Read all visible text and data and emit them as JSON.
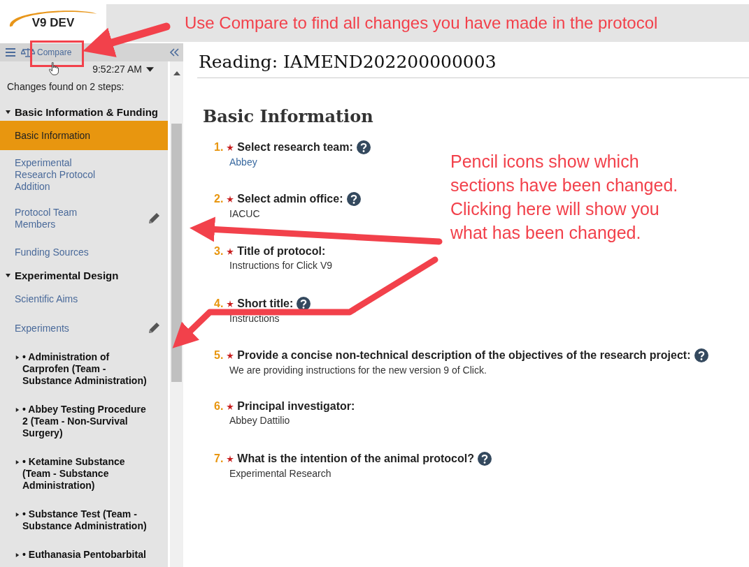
{
  "header": {
    "logo": "V9 DEV"
  },
  "annotations": [
    {
      "kind": "banner",
      "text": "Use Compare to find all changes you have made in the protocol"
    },
    {
      "kind": "callout",
      "text": "Pencil icons show which sections have been changed. Clicking here will show you what has been changed."
    }
  ],
  "sidebar": {
    "compare_button": "Compare",
    "date": "9:52:27 AM",
    "summary": "Changes found on 2 steps:",
    "sections": [
      {
        "label": "Basic Information & Funding",
        "expanded": true,
        "items": [
          {
            "kind": "link",
            "label": "Basic Information",
            "selected": true,
            "changed": false
          },
          {
            "kind": "link",
            "label": "Experimental Research Protocol Addition",
            "selected": false,
            "changed": false
          },
          {
            "kind": "link",
            "label": "Protocol Team Members",
            "selected": false,
            "changed": true
          },
          {
            "kind": "link",
            "label": "Funding Sources",
            "selected": false,
            "changed": false
          }
        ]
      },
      {
        "label": "Experimental Design",
        "expanded": true,
        "items": [
          {
            "kind": "link",
            "label": "Scientific Aims",
            "selected": false,
            "changed": false
          },
          {
            "kind": "link",
            "label": "Experiments",
            "selected": false,
            "changed": true
          },
          {
            "kind": "step",
            "label": "• Administration of Carprofen (Team - Substance Administration)",
            "expanded": false
          },
          {
            "kind": "step",
            "label": "• Abbey Testing Procedure 2 (Team - Non-Survival Surgery)",
            "expanded": false
          },
          {
            "kind": "step",
            "label": "• Ketamine Substance (Team - Substance Administration)",
            "expanded": false
          },
          {
            "kind": "step",
            "label": "• Substance Test (Team - Substance Administration)",
            "expanded": false
          },
          {
            "kind": "step",
            "label": "• Euthanasia Pentobarbital",
            "expanded": false
          }
        ]
      }
    ]
  },
  "main": {
    "title": "Reading: IAMEND202200000003",
    "section": "Basic Information",
    "questions": [
      {
        "number": "1.",
        "label": "Select research team:",
        "help": true,
        "answer": "Abbey",
        "answer_link": true
      },
      {
        "number": "2.",
        "label": "Select admin office:",
        "help": true,
        "answer": "IACUC",
        "answer_link": false
      },
      {
        "number": "3.",
        "label": "Title of protocol:",
        "help": false,
        "answer": "Instructions for Click V9",
        "answer_link": false
      },
      {
        "number": "4.",
        "label": "Short title:",
        "help": true,
        "answer": "Instructions",
        "answer_link": false
      },
      {
        "number": "5.",
        "label": "Provide a concise non-technical description of the objectives of the research project:",
        "help": true,
        "answer": "We are providing instructions for the new version 9 of Click.",
        "answer_link": false
      },
      {
        "number": "6.",
        "label": "Principal investigator:",
        "help": false,
        "answer": "Abbey Dattilio",
        "answer_link": false
      },
      {
        "number": "7.",
        "label": "What is the intention of the animal protocol?",
        "help": true,
        "answer": "Experimental Research",
        "answer_link": false
      }
    ]
  }
}
